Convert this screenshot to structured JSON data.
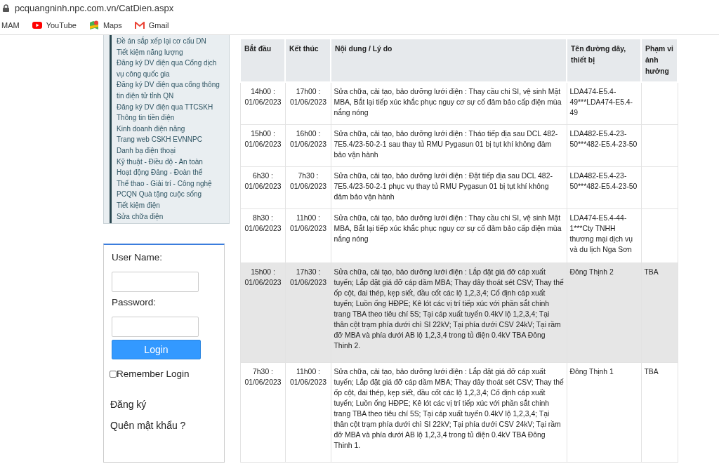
{
  "browser": {
    "url": "pcquangninh.npc.com.vn/CatDien.aspx",
    "bookmarks": [
      {
        "label": "MAM",
        "kind": "plain"
      },
      {
        "label": "YouTube",
        "kind": "youtube"
      },
      {
        "label": "Maps",
        "kind": "maps"
      },
      {
        "label": "Gmail",
        "kind": "gmail"
      }
    ]
  },
  "sidebar": {
    "items": [
      "Đề án sắp xếp lại cơ cấu DN",
      "Tiết kiệm năng lượng",
      "Đăng ký DV điện qua Cổng dịch vụ công quốc gia",
      "Đăng ký DV điện qua cổng thông tin điện tử tỉnh QN",
      "Đăng ký DV điện qua TTCSKH",
      "Thông tin tiền điện",
      "Kinh doanh điện năng",
      "Trang web CSKH EVNNPC",
      "Danh bạ điện thoại",
      "Kỹ thuật - Điều độ - An toàn",
      "Hoạt động Đảng - Đoàn thể",
      "Thể thao - Giải trí - Công nghệ",
      "PCQN Quà tặng cuộc sống",
      "Tiết kiệm điện",
      "Sửa chữa điện"
    ]
  },
  "login": {
    "username_label": "User Name:",
    "password_label": "Password:",
    "button": "Login",
    "remember": {
      "label": "Remember Login",
      "checked": false
    },
    "links": [
      "Đăng ký",
      "Quên mật khẩu ?"
    ]
  },
  "table": {
    "columns": [
      "Bắt đầu",
      "Kết thúc",
      "Nội dung / Lý do",
      "Tên đường dây, thiết bị",
      "Phạm vi ảnh hưởng"
    ],
    "rows": [
      {
        "highlighted": false,
        "cells": [
          "14h00 : 01/06/2023",
          "17h00 : 01/06/2023",
          "Sửa chữa, cải tạo, bảo dưỡng lưới điện : Thay cầu chi SI, vệ sinh Mặt MBA, Bắt lại tiếp xúc khắc phục nguy cơ sự cố đảm bảo cấp điện mùa nắng nóng",
          "LDA474-E5.4-49***LDA474-E5.4-49",
          ""
        ]
      },
      {
        "highlighted": false,
        "cells": [
          "15h00 : 01/06/2023",
          "16h00 : 01/06/2023",
          "Sửa chữa, cải tạo, bảo dưỡng lưới điện : Tháo tiếp địa sau DCL 482-7E5.4/23-50-2-1 sau thay tủ RMU Pygasun 01 bị tụt khí không đảm bảo vận hành",
          "LDA482-E5.4-23-50***482-E5.4-23-50",
          ""
        ]
      },
      {
        "highlighted": false,
        "cells": [
          "6h30 : 01/06/2023",
          "7h30 : 01/06/2023",
          "Sửa chữa, cải tạo, bảo dưỡng lưới điện : Đặt tiếp địa sau DCL 482-7E5.4/23-50-2-1 phục vụ thay tủ RMU Pygasun 01 bị tụt khí không đảm bảo vận hành",
          "LDA482-E5.4-23-50***482-E5.4-23-50",
          ""
        ]
      },
      {
        "highlighted": false,
        "cells": [
          "8h30 : 01/06/2023",
          "11h00 : 01/06/2023",
          "Sửa chữa, cải tạo, bảo dưỡng lưới điện : Thay cầu chi SI, vệ sinh Mặt MBA, Bắt lại tiếp xúc khắc phục nguy cơ sự cố đảm bảo cấp điện mùa nắng nóng",
          "LDA474-E5.4-44-1***Cty TNHH thương mại dịch vụ và du lịch Nga Sơn",
          ""
        ]
      },
      {
        "highlighted": true,
        "cells": [
          "15h00 : 01/06/2023",
          "17h30 : 01/06/2023",
          "Sửa chữa, cải tạo, bảo dưỡng lưới điện : Lắp đặt giá đỡ cáp xuất tuyến; Lắp đặt giá đỡ cáp dầm MBA; Thay dây thoát sét CSV; Thay thế ốp cột, đai thép, kẹp siết, đầu cốt các lộ 1,2,3,4; Cố định cáp xuất tuyến; Luồn ống HĐPE; Kê lót các vị trí tiếp xúc với phần sắt chinh trang TBA theo tiêu chí 5S; Tại cáp xuất tuyến 0.4kV lộ 1,2,3,4; Tại thân cột trạm phía dưới chì SI 22kV; Tại phía dưới CSV 24kV; Tại rầm đỡ MBA và phía dưới AB lộ 1,2,3,4 trong tủ điện 0.4kV TBA Đông Thinh 2.",
          "Đông Thịnh 2",
          "TBA"
        ]
      },
      {
        "highlighted": false,
        "cells": [
          "7h30 : 01/06/2023",
          "11h00 : 01/06/2023",
          "Sửa chữa, cải tạo, bảo dưỡng lưới điện : Lắp đặt giá đỡ cáp xuất tuyến; Lắp đặt giá đỡ cáp dầm MBA; Thay dây thoát sét CSV; Thay thế ốp cột, đai thép, kẹp siết, đầu cốt các lộ 1,2,3,4; Cố định cáp xuất tuyến; Luồn ống HĐPE; Kê lót các vị trí tiếp xúc với phần sắt chinh trang TBA theo tiêu chí 5S; Tại cáp xuất tuyến 0.4kV lộ 1,2,3,4; Tại thân cột trạm phía dưới chì SI 22kV; Tại phía dưới CSV 24kV; Tại rầm đỡ MBA và phía dưới AB lộ 1,2,3,4 trong tủ điện 0.4kV TBA Đông Thinh 1.",
          "Đông Thịnh 1",
          "TBA"
        ]
      }
    ]
  }
}
